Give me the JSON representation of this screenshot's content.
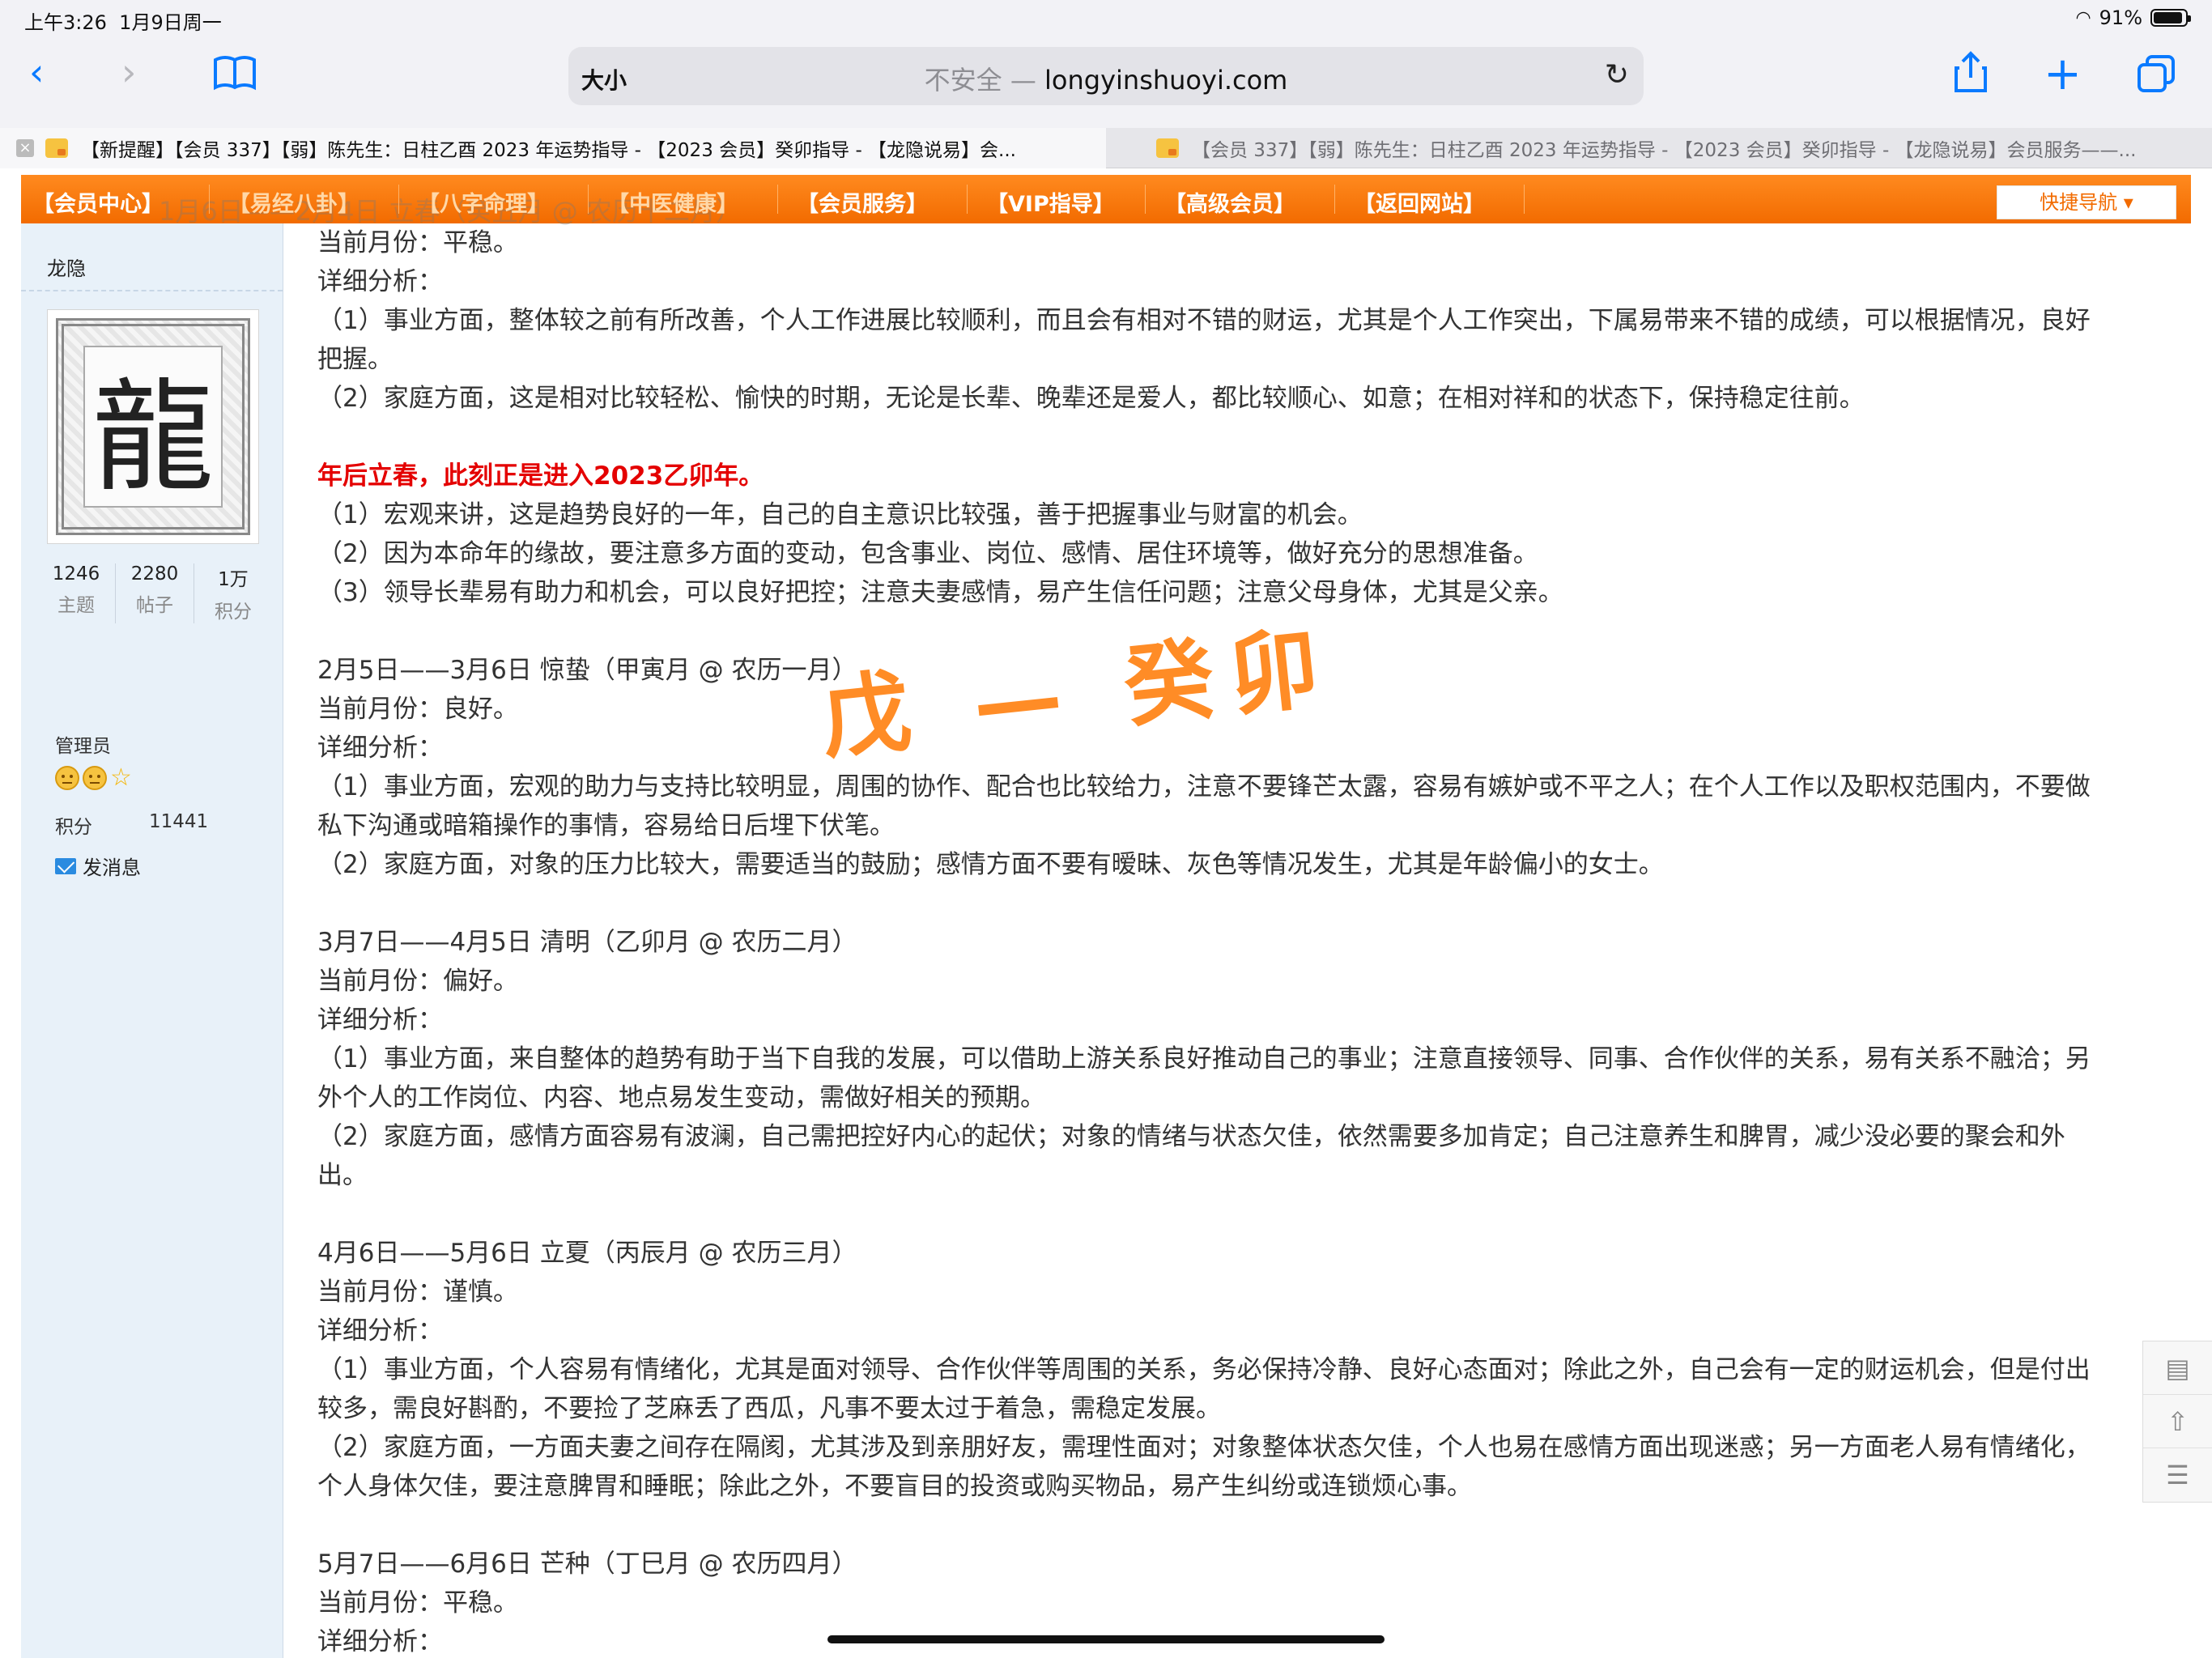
{
  "status": {
    "time": "上午3:26",
    "date": "1月9日周一",
    "battery": "91%",
    "battery_level": 0.91
  },
  "toolbar": {
    "back_icon": "chevron-left-icon",
    "forward_icon": "chevron-right-icon",
    "bookmarks_icon": "book-icon",
    "text_size": "大小",
    "insecure_label": "不安全 — ",
    "domain": "longyinshuoyi.com",
    "reload_icon": "reload-icon",
    "share_icon": "share-icon",
    "add_icon": "plus-icon",
    "tabs_icon": "tabs-icon"
  },
  "tabs": [
    {
      "title": "【新提醒】【会员 337】【弱】陈先生：日柱乙酉 2023 年运势指导 - 【2023 会员】癸卯指导 - 【龙隐说易】会..."
    },
    {
      "title": "【会员 337】【弱】陈先生：日柱乙酉 2023 年运势指导 - 【2023 会员】癸卯指导 - 【龙隐说易】会员服务——..."
    }
  ],
  "nav": {
    "items": [
      "【会员中心】",
      "【易经八卦】",
      "【八字命理】",
      "【中医健康】",
      "【会员服务】",
      "【VIP指导】",
      "【高级会员】",
      "【返回网站】"
    ],
    "quick_nav": "快捷导航 ▾",
    "overlay_text": "1月6日——2月4日 立春（癸丑月 @ 农历十二月）"
  },
  "sidebar": {
    "username": "龙隐",
    "avatar_char": "龍",
    "stats": [
      {
        "value": "1246",
        "label": "主题"
      },
      {
        "value": "2280",
        "label": "帖子"
      },
      {
        "value": "1万",
        "label": "积分"
      }
    ],
    "role": "管理员",
    "points_label": "积分",
    "points_value": "11441",
    "message": "发消息"
  },
  "content": {
    "lines": [
      "当前月份：平稳。",
      "详细分析：",
      "（1）事业方面，整体较之前有所改善，个人工作进展比较顺利，而且会有相对不错的财运，尤其是个人工作突出，下属易带来不错的成绩，可以根据情况，良好",
      "把握。",
      "（2）家庭方面，这是相对比较轻松、愉快的时期，无论是长辈、晚辈还是爱人，都比较顺心、如意；在相对祥和的状态下，保持稳定往前。"
    ],
    "red_line": "年后立春，此刻正是进入2023乙卯年。",
    "lines2": [
      "（1）宏观来讲，这是趋势良好的一年，自己的自主意识比较强，善于把握事业与财富的机会。",
      "（2）因为本命年的缘故，要注意多方面的变动，包含事业、岗位、感情、居住环境等，做好充分的思想准备。",
      "（3）领导长辈易有助力和机会，可以良好把控；注意夫妻感情，易产生信任问题；注意父母身体，尤其是父亲。"
    ],
    "sections": [
      {
        "heading": "2月5日——3月6日 惊蛰（甲寅月 @ 农历一月）",
        "lines": [
          "当前月份：良好。",
          "详细分析：",
          "（1）事业方面，宏观的助力与支持比较明显，周围的协作、配合也比较给力，注意不要锋芒太露，容易有嫉妒或不平之人；在个人工作以及职权范围内，不要做",
          "私下沟通或暗箱操作的事情，容易给日后埋下伏笔。",
          "（2）家庭方面，对象的压力比较大，需要适当的鼓励；感情方面不要有暧昧、灰色等情况发生，尤其是年龄偏小的女士。"
        ]
      },
      {
        "heading": "3月7日——4月5日 清明（乙卯月 @ 农历二月）",
        "lines": [
          "当前月份：偏好。",
          "详细分析：",
          "（1）事业方面，来自整体的趋势有助于当下自我的发展，可以借助上游关系良好推动自己的事业；注意直接领导、同事、合作伙伴的关系，易有关系不融洽；另",
          "外个人的工作岗位、内容、地点易发生变动，需做好相关的预期。",
          "（2）家庭方面，感情方面容易有波澜，自己需把控好内心的起伏；对象的情绪与状态欠佳，依然需要多加肯定；自己注意养生和脾胃，减少没必要的聚会和外",
          "出。"
        ]
      },
      {
        "heading": "4月6日——5月6日 立夏（丙辰月 @ 农历三月）",
        "lines": [
          "当前月份：谨慎。",
          "详细分析：",
          "（1）事业方面，个人容易有情绪化，尤其是面对领导、合作伙伴等周围的关系，务必保持冷静、良好心态面对；除此之外，自己会有一定的财运机会，但是付出",
          "较多，需良好斟酌，不要捡了芝麻丢了西瓜，凡事不要太过于着急，需稳定发展。",
          "（2）家庭方面，一方面夫妻之间存在隔阂，尤其涉及到亲朋好友，需理性面对；对象整体状态欠佳，个人也易在感情方面出现迷惑；另一方面老人易有情绪化，",
          "个人身体欠佳，要注意脾胃和睡眠；除此之外，不要盲目的投资或购买物品，易产生纠纷或连锁烦心事。"
        ]
      },
      {
        "heading": "5月7日——6月6日 芒种（丁巳月 @ 农历四月）",
        "lines": [
          "当前月份：平稳。",
          "详细分析："
        ]
      }
    ],
    "handwriting": "戊 — 癸卯"
  },
  "float_tools": [
    "comment-icon",
    "back-to-top-icon",
    "list-icon"
  ],
  "colors": {
    "accent": "#f26b00",
    "link_blue": "#0a7aff",
    "red": "#e40000",
    "sidebar_bg": "#e8f1f9"
  }
}
